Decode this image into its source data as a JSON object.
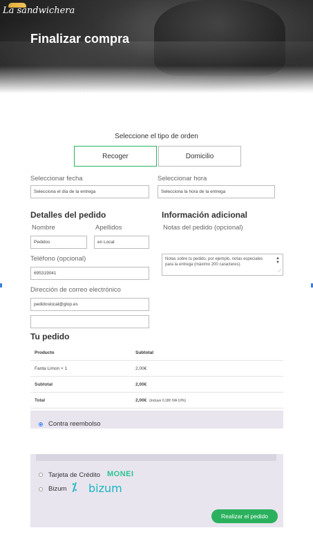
{
  "header": {
    "logo_text": "La sandwichera",
    "title": "Finalizar compra"
  },
  "order_type": {
    "label": "Seleccione el tipo de orden",
    "options": [
      "Recoger",
      "Domicilio"
    ],
    "selected": "Recoger"
  },
  "schedule": {
    "date_label": "Seleccionar fecha",
    "date_placeholder": "Selecciona el día de la entrega",
    "time_label": "Seleccionar hora",
    "time_placeholder": "Selecciona la hora de la entrega"
  },
  "details": {
    "heading": "Detalles del pedido",
    "first_name_label": "Nombre",
    "first_name_value": "Pedidos",
    "last_name_label": "Apellidos",
    "last_name_value": "en Local",
    "phone_label": "Teléfono (opcional)",
    "phone_value": "695319041",
    "email_label": "Dirección de correo electrónico",
    "email_value": "pedidoslocal@glop.es",
    "extra_value": ""
  },
  "additional": {
    "heading": "Información adicional",
    "notes_label": "Notas del pedido (opcional)",
    "notes_placeholder": "Notas sobre tu pedido, por ejemplo, notas especiales para la entrega (máximo 200 caracteres)."
  },
  "order": {
    "heading": "Tu pedido",
    "columns": [
      "Producto",
      "Subtotal"
    ],
    "rows": [
      {
        "product": "Fanta Limon  × 1",
        "subtotal": "2,00€"
      }
    ],
    "subtotal_label": "Subtotal",
    "subtotal_value": "2,00€",
    "total_label": "Total",
    "total_value": "2,00€",
    "total_note": "(incluye 0,18€ IVA 10%)"
  },
  "payment": {
    "methods": [
      {
        "label": "Contra reembolso",
        "selected": true
      },
      {
        "label": "Tarjeta de Crédito",
        "brand": "MONEI",
        "selected": false
      },
      {
        "label": "Bizum",
        "brand": "bizum",
        "selected": false
      }
    ],
    "submit_label": "Realizar el pedido"
  },
  "colors": {
    "accent": "#2bb15d",
    "monei": "#2bc48e",
    "bizum": "#1bb5c1",
    "payment_bg": "#e8e5ef"
  }
}
